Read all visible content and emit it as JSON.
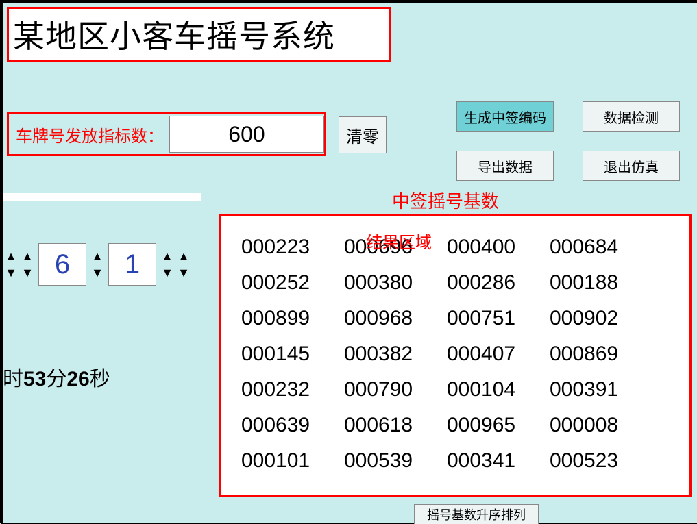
{
  "title": "某地区小客车摇号系统",
  "quota": {
    "label": "车牌号发放指标数：",
    "value": "600"
  },
  "clear_label": "清零",
  "buttons": {
    "generate": "生成中签编码",
    "check": "数据检测",
    "export": "导出数据",
    "exit": "退出仿真"
  },
  "base_label": "中签摇号基数",
  "result_area_label": "结果区域",
  "steppers": [
    {
      "value": ""
    },
    {
      "value": "6"
    },
    {
      "value": "1"
    },
    {
      "value": ""
    }
  ],
  "time": {
    "prefix": "时",
    "min": "53",
    "min_suffix": "分",
    "sec": "26",
    "sec_suffix": "秒"
  },
  "results": [
    [
      "000223",
      "000696",
      "000400",
      "000684"
    ],
    [
      "000252",
      "000380",
      "000286",
      "000188"
    ],
    [
      "000899",
      "000968",
      "000751",
      "000902"
    ],
    [
      "000145",
      "000382",
      "000407",
      "000869"
    ],
    [
      "000232",
      "000790",
      "000104",
      "000391"
    ],
    [
      "000639",
      "000618",
      "000965",
      "000008"
    ],
    [
      "000101",
      "000539",
      "000341",
      "000523"
    ]
  ],
  "sort_label": "摇号基数升序排列"
}
